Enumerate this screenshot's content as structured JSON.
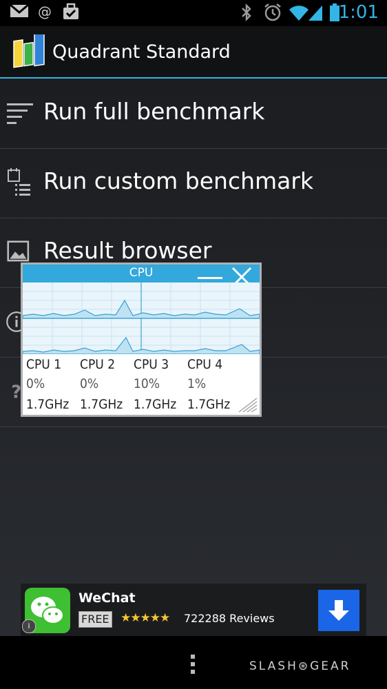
{
  "status_bar": {
    "time": "1:01",
    "icons": [
      "gmail-icon",
      "at-icon",
      "tasks-icon",
      "bluetooth-icon",
      "alarm-icon",
      "wifi-icon",
      "signal-icon",
      "battery-icon"
    ]
  },
  "app": {
    "title": "Quadrant Standard"
  },
  "menu": {
    "items": [
      {
        "label": "Run full benchmark",
        "icon": "list-lines-icon"
      },
      {
        "label": "Run custom benchmark",
        "icon": "custom-list-icon"
      },
      {
        "label": "Result browser",
        "icon": "image-icon"
      },
      {
        "label": "",
        "icon": "info-icon"
      },
      {
        "label": "",
        "icon": "help-icon"
      }
    ]
  },
  "cpu_widget": {
    "title": "CPU",
    "cpus": [
      {
        "name": "CPU 1",
        "usage": "0%",
        "freq": "1.7GHz"
      },
      {
        "name": "CPU 2",
        "usage": "0%",
        "freq": "1.7GHz"
      },
      {
        "name": "CPU 3",
        "usage": "10%",
        "freq": "1.7GHz"
      },
      {
        "name": "CPU 4",
        "usage": "1%",
        "freq": "1.7GHz"
      }
    ]
  },
  "ad": {
    "title": "WeChat",
    "badge": "FREE",
    "stars": "★★★★★",
    "reviews": "722288 Reviews",
    "info": "i"
  },
  "watermark": "SLASH⊛GEAR",
  "colors": {
    "accent": "#33b5e5",
    "ad_icon": "#3fbf32",
    "download": "#1a66e6"
  }
}
